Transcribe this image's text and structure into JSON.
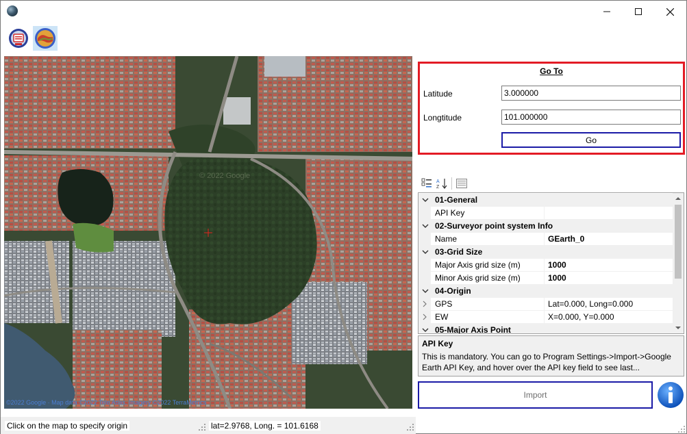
{
  "titlebar": {
    "icons": [
      "earth-app-icon",
      "minimize-icon",
      "maximize-icon",
      "close-icon"
    ]
  },
  "toolbar": {
    "tools": [
      {
        "icon": "program-settings-icon"
      },
      {
        "icon": "google-earth-icon",
        "selected": true
      }
    ]
  },
  "map": {
    "credit": "©2022 Google · Map data ©2022 Tele Atlas, Imagery ©2022 TerraMetrics",
    "watermark": "© 2022 Google",
    "marker_icon": "crosshair-marker-icon"
  },
  "status": {
    "hint": "Click on the map to specify origin",
    "coords": "lat=2.9768, Long. = 101.6168"
  },
  "goto": {
    "title": "Go To",
    "latitude_label": "Latitude",
    "latitude_value": "3.000000",
    "longitude_label": "Longtitude",
    "longitude_value": "101.000000",
    "go_label": "Go",
    "accent_color": "#e31b25"
  },
  "property_grid": {
    "toolbar_icons": [
      "categorized-icon",
      "alphabetical-sort-icon",
      "property-pages-icon"
    ],
    "rows": [
      {
        "kind": "category",
        "label": "01-General"
      },
      {
        "kind": "property",
        "name": "API Key",
        "value": ""
      },
      {
        "kind": "category",
        "label": "02-Surveyor point system Info"
      },
      {
        "kind": "property",
        "name": "Name",
        "value": "GEarth_0",
        "bold": true
      },
      {
        "kind": "category",
        "label": "03-Grid Size"
      },
      {
        "kind": "property",
        "name": "Major Axis grid size (m)",
        "value": "1000",
        "bold": true
      },
      {
        "kind": "property",
        "name": "Minor Axis grid size (m)",
        "value": "1000",
        "bold": true
      },
      {
        "kind": "category",
        "label": "04-Origin"
      },
      {
        "kind": "property",
        "name": "GPS",
        "value": "Lat=0.000, Long=0.000",
        "expandable": true
      },
      {
        "kind": "property",
        "name": "EW",
        "value": "X=0.000, Y=0.000",
        "expandable": true
      },
      {
        "kind": "category",
        "label": "05-Major Axis Point"
      }
    ]
  },
  "help": {
    "title": "API Key",
    "body": "This is mandatory. You can go to Program Settings->Import->Google Earth API Key, and hover over the API key field to see last..."
  },
  "actions": {
    "import_label": "Import",
    "info_icon": "info-icon",
    "button_border_color": "#1a1aa6"
  }
}
